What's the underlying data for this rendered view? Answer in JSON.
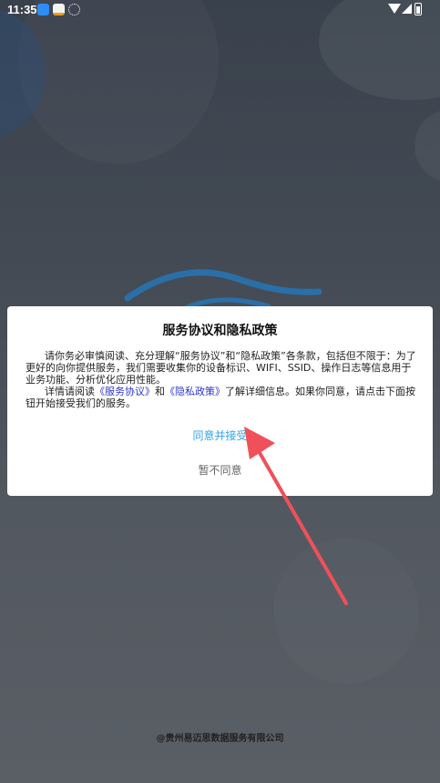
{
  "status_bar": {
    "time": "11:35"
  },
  "dialog": {
    "title": "服务协议和隐私政策",
    "para1": "请你务必审慎阅读、充分理解“服务协议”和“隐私政策”各条款，包括但不限于：为了更好的向你提供服务，我们需要收集你的设备标识、WIFI、SSID、操作日志等信息用于业务功能、分析优化应用性能。",
    "para2_prefix": "详情请阅读",
    "link_service": "《服务协议》",
    "para2_and": "和",
    "link_privacy": "《隐私政策》",
    "para2_suffix": "了解详细信息。如果你同意，请点击下面按钮开始接受我们的服务。",
    "accept_label": "同意并接受",
    "decline_label": "暂不同意"
  },
  "footer": {
    "company": "@贵州易迈思数据服务有限公司"
  },
  "colors": {
    "accent": "#35a4e0",
    "link": "#2d37c9",
    "arrow": "#f0505a"
  }
}
